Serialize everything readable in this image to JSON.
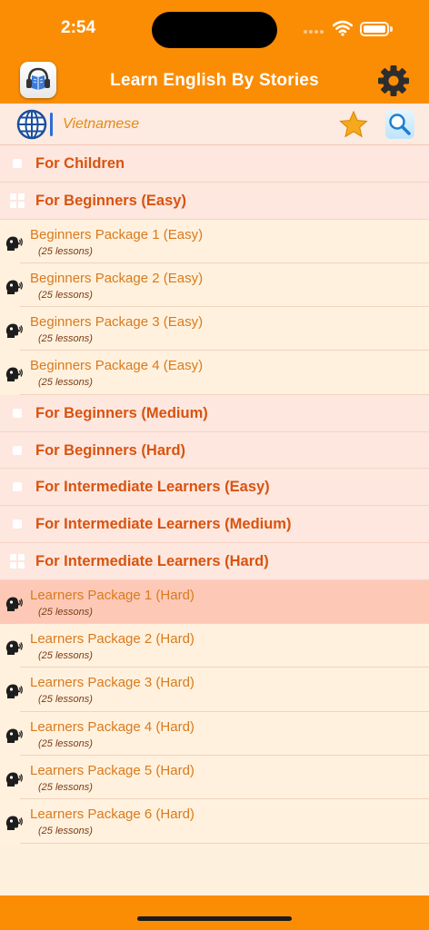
{
  "status_bar": {
    "time": "2:54"
  },
  "header": {
    "title": "Learn English By Stories"
  },
  "language_bar": {
    "language": "Vietnamese"
  },
  "sections": [
    {
      "label": "For Children",
      "expanded": false,
      "items": []
    },
    {
      "label": "For Beginners (Easy)",
      "expanded": true,
      "items": [
        {
          "title": "Beginners Package 1 (Easy)",
          "subtitle": "(25 lessons)"
        },
        {
          "title": "Beginners Package 2 (Easy)",
          "subtitle": "(25 lessons)"
        },
        {
          "title": "Beginners Package 3 (Easy)",
          "subtitle": "(25 lessons)"
        },
        {
          "title": "Beginners Package 4 (Easy)",
          "subtitle": "(25 lessons)"
        }
      ]
    },
    {
      "label": "For Beginners (Medium)",
      "expanded": false,
      "items": []
    },
    {
      "label": "For Beginners (Hard)",
      "expanded": false,
      "items": []
    },
    {
      "label": "For Intermediate Learners (Easy)",
      "expanded": false,
      "items": []
    },
    {
      "label": "For Intermediate Learners (Medium)",
      "expanded": false,
      "items": []
    },
    {
      "label": "For Intermediate Learners (Hard)",
      "expanded": true,
      "items": [
        {
          "title": "Learners Package 1 (Hard)",
          "subtitle": "(25 lessons)",
          "selected": true
        },
        {
          "title": "Learners Package 2 (Hard)",
          "subtitle": "(25 lessons)"
        },
        {
          "title": "Learners Package 3 (Hard)",
          "subtitle": "(25 lessons)"
        },
        {
          "title": "Learners Package 4 (Hard)",
          "subtitle": "(25 lessons)"
        },
        {
          "title": "Learners Package 5 (Hard)",
          "subtitle": "(25 lessons)"
        },
        {
          "title": "Learners Package 6 (Hard)",
          "subtitle": "(25 lessons)"
        }
      ]
    }
  ],
  "colors": {
    "accent": "#fb8d05",
    "category_text": "#d9530e",
    "item_text": "#d97a1e",
    "selected_row": "#fdc9b6"
  },
  "icons": {
    "app_logo": "book-headphones-icon",
    "settings": "gear-icon",
    "language": "globe-icon",
    "favorites": "star-icon",
    "search": "search-icon",
    "lesson": "listening-head-icon"
  }
}
